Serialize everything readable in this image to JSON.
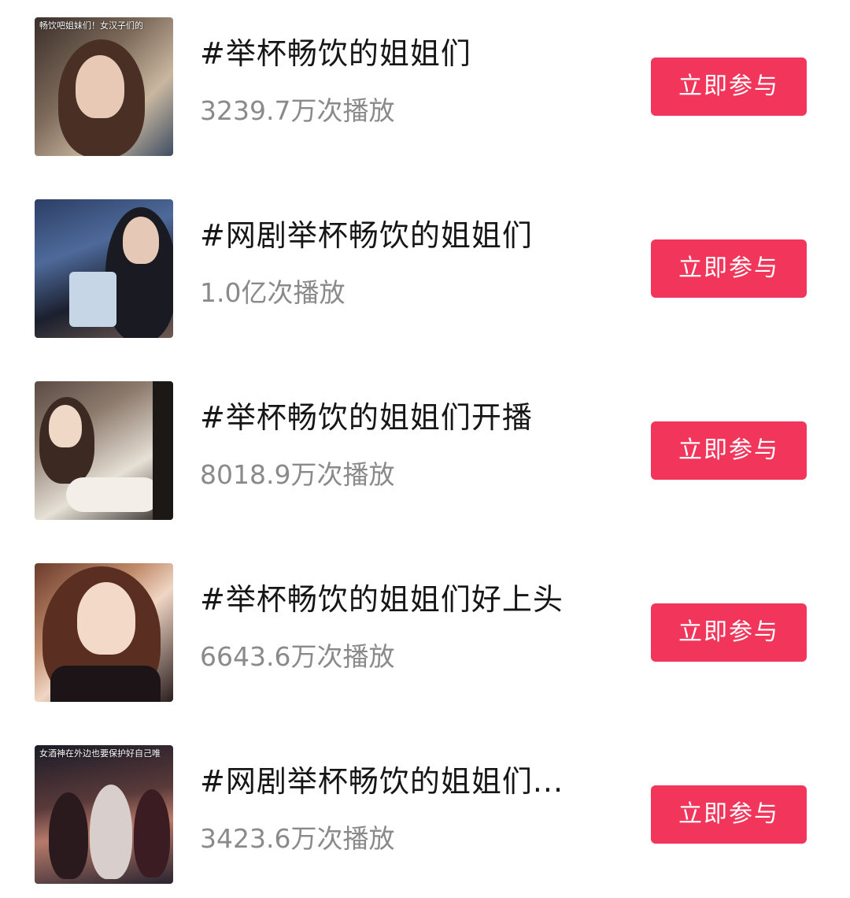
{
  "topics": [
    {
      "title": "#举杯畅饮的姐姐们",
      "plays": "3239.7万次播放",
      "button": "立即参与",
      "thumb_caption": "畅饮吧姐妹们！女汉子们的"
    },
    {
      "title": "#网剧举杯畅饮的姐姐们",
      "plays": "1.0亿次播放",
      "button": "立即参与",
      "thumb_caption": ""
    },
    {
      "title": "#举杯畅饮的姐姐们开播",
      "plays": "8018.9万次播放",
      "button": "立即参与",
      "thumb_caption": ""
    },
    {
      "title": "#举杯畅饮的姐姐们好上头",
      "plays": "6643.6万次播放",
      "button": "立即参与",
      "thumb_caption": ""
    },
    {
      "title": "#网剧举杯畅饮的姐姐们...",
      "plays": "3423.6万次播放",
      "button": "立即参与",
      "thumb_caption": "女酒神在外边也要保护好自己唯"
    }
  ],
  "colors": {
    "button_bg": "#f2365b",
    "title_text": "#161616",
    "plays_text": "#8a8a8a"
  }
}
